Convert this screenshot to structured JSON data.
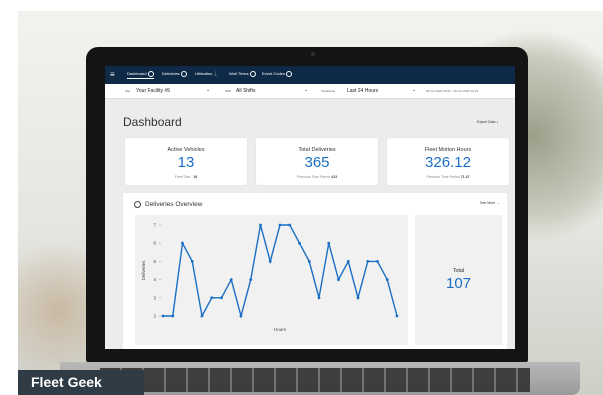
{
  "nav": {
    "tabs": [
      {
        "label": "Dashboard",
        "active": true
      },
      {
        "label": "Deliveries"
      },
      {
        "label": "Utilization"
      },
      {
        "label": "Wait Times"
      },
      {
        "label": "Event Codes"
      }
    ]
  },
  "filters": {
    "site_label": "Site",
    "site_value": "Your Facility #5",
    "shift_label": "Shift",
    "shift_value": "All Shifts",
    "timeframe_label": "Timeframe",
    "timeframe_value": "Last 24 Hours",
    "date_range": "28 Oct 2020 10:23 - 29 Oct 2020 10:23"
  },
  "page": {
    "title": "Dashboard",
    "export_label": "Export Data"
  },
  "cards": [
    {
      "title": "Active Vehicles",
      "value": "13",
      "sub_label": "Fleet Size",
      "sub_value": "16"
    },
    {
      "title": "Total Deliveries",
      "value": "365",
      "sub_label": "Previous Time Period",
      "sub_value": "413"
    },
    {
      "title": "Fleet Motion Hours",
      "value": "326.12",
      "sub_label": "Previous Time Period",
      "sub_value": "71.47"
    }
  ],
  "overview": {
    "title": "Deliveries Overview",
    "see_more": "See More"
  },
  "total": {
    "label": "Total",
    "value": "107"
  },
  "chart_data": {
    "type": "line",
    "xlabel": "Hours",
    "ylabel": "Deliveries",
    "ylim": [
      2,
      7
    ],
    "yticks": [
      "2",
      "3",
      "4",
      "5",
      "6",
      "7"
    ],
    "grid": false,
    "series": [
      {
        "values": [
          2,
          2,
          6,
          5,
          2,
          3,
          3,
          4,
          2,
          4,
          7,
          5,
          7,
          7,
          6,
          5,
          3,
          6,
          4,
          5,
          3,
          5,
          5,
          4,
          2
        ]
      }
    ],
    "color": "#1a6fc4"
  },
  "banner": {
    "text": "Fleet Geek"
  }
}
